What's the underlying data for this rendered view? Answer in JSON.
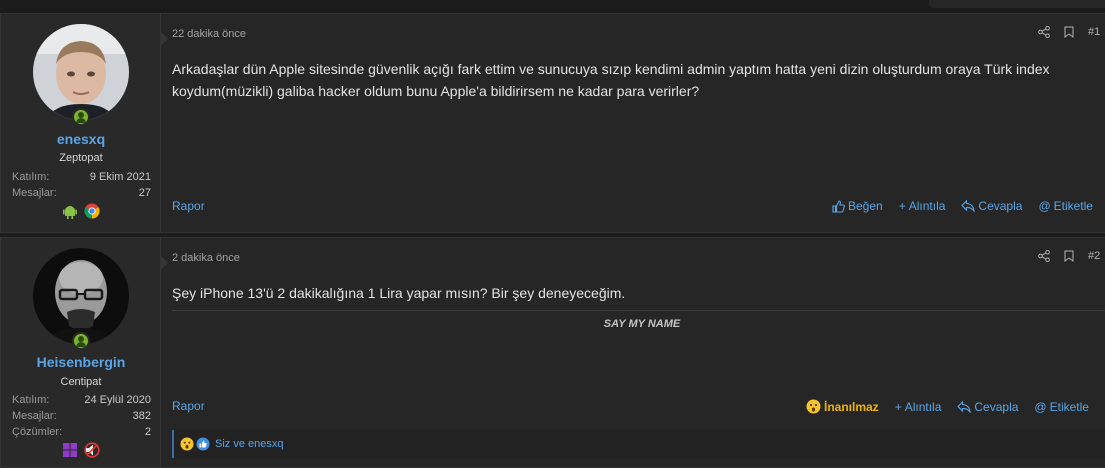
{
  "posts": [
    {
      "user": {
        "name": "enesxq",
        "title": "Zeptopat",
        "stats": [
          {
            "label": "Katılım:",
            "value": "9 Ekim 2021"
          },
          {
            "label": "Mesajlar:",
            "value": "27"
          }
        ],
        "badges": [
          "android-icon",
          "chrome-icon"
        ]
      },
      "date": "22 dakika önce",
      "number": "#1",
      "message": "Arkadaşlar dün Apple sitesinde güvenlik açığı fark ettim ve sunucuya sızıp kendimi admin yaptım hatta yeni dizin oluşturdum oraya Türk index koydum(müzikli) galiba hacker oldum bunu Apple'a bildirirsem ne kadar para verirler?",
      "report": "Rapor",
      "actions": {
        "like": "Beğen",
        "quote": "Alıntıla",
        "reply": "Cevapla",
        "tag": "Etiketle"
      }
    },
    {
      "user": {
        "name": "Heisenbergin",
        "title": "Centipat",
        "stats": [
          {
            "label": "Katılım:",
            "value": "24 Eylül 2020"
          },
          {
            "label": "Mesajlar:",
            "value": "382"
          },
          {
            "label": "Çözümler:",
            "value": "2"
          }
        ],
        "badges": [
          "windows-icon",
          "no-sound-icon"
        ]
      },
      "date": "2 dakika önce",
      "number": "#2",
      "message": "Şey iPhone 13'ü 2 dakikalığına 1 Lira yapar mısın? Bir şey deneyeceğim.",
      "signature": "SAY MY NAME",
      "report": "Rapor",
      "actions": {
        "reaction": "İnanılmaz",
        "quote": "Alıntıla",
        "reply": "Cevapla",
        "tag": "Etiketle"
      },
      "reactions_text": "Siz ve enesxq"
    }
  ],
  "colors": {
    "accent": "#5aa5e6",
    "online": "#78b52b",
    "reaction": "#f1b400"
  }
}
